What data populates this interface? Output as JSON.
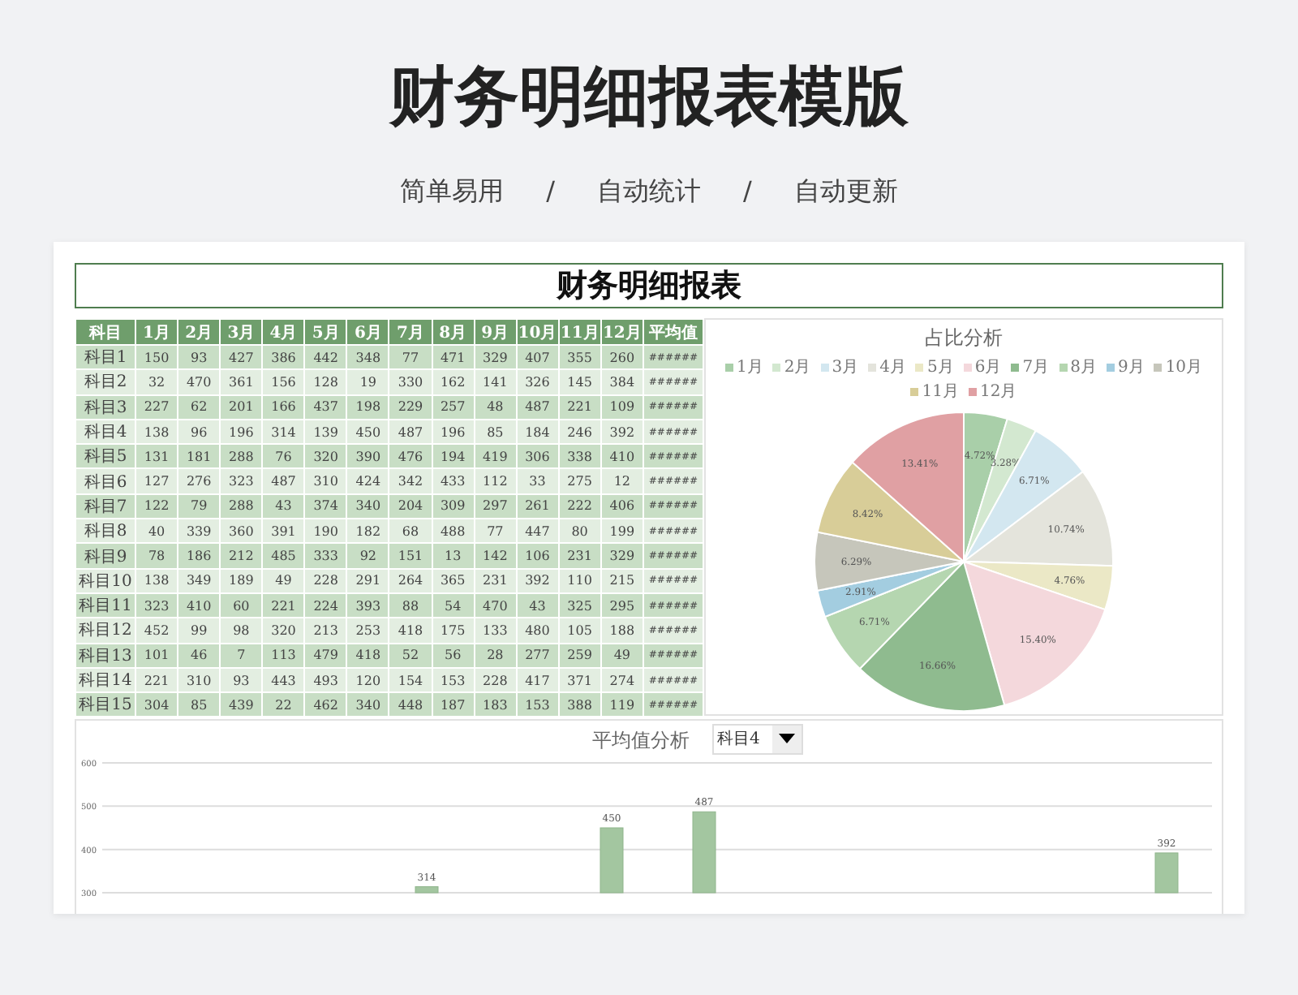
{
  "header": {
    "title": "财务明细报表模版",
    "tags": [
      "简单易用",
      "自动统计",
      "自动更新"
    ],
    "separators": [
      "/",
      "/"
    ]
  },
  "report": {
    "title": "财务明细报表",
    "table": {
      "columns": [
        "科目",
        "1月",
        "2月",
        "3月",
        "4月",
        "5月",
        "6月",
        "7月",
        "8月",
        "9月",
        "10月",
        "11月",
        "12月",
        "平均值"
      ],
      "rows": [
        [
          "科目1",
          "150",
          "93",
          "427",
          "386",
          "442",
          "348",
          "77",
          "471",
          "329",
          "407",
          "355",
          "260",
          "######"
        ],
        [
          "科目2",
          "32",
          "470",
          "361",
          "156",
          "128",
          "19",
          "330",
          "162",
          "141",
          "326",
          "145",
          "384",
          "######"
        ],
        [
          "科目3",
          "227",
          "62",
          "201",
          "166",
          "437",
          "198",
          "229",
          "257",
          "48",
          "487",
          "221",
          "109",
          "######"
        ],
        [
          "科目4",
          "138",
          "96",
          "196",
          "314",
          "139",
          "450",
          "487",
          "196",
          "85",
          "184",
          "246",
          "392",
          "######"
        ],
        [
          "科目5",
          "131",
          "181",
          "288",
          "76",
          "320",
          "390",
          "476",
          "194",
          "419",
          "306",
          "338",
          "410",
          "######"
        ],
        [
          "科目6",
          "127",
          "276",
          "323",
          "487",
          "310",
          "424",
          "342",
          "433",
          "112",
          "33",
          "275",
          "12",
          "######"
        ],
        [
          "科目7",
          "122",
          "79",
          "288",
          "43",
          "374",
          "340",
          "204",
          "309",
          "297",
          "261",
          "222",
          "406",
          "######"
        ],
        [
          "科目8",
          "40",
          "339",
          "360",
          "391",
          "190",
          "182",
          "68",
          "488",
          "77",
          "447",
          "80",
          "199",
          "######"
        ],
        [
          "科目9",
          "78",
          "186",
          "212",
          "485",
          "333",
          "92",
          "151",
          "13",
          "142",
          "106",
          "231",
          "329",
          "######"
        ],
        [
          "科目10",
          "138",
          "349",
          "189",
          "49",
          "228",
          "291",
          "264",
          "365",
          "231",
          "392",
          "110",
          "215",
          "######"
        ],
        [
          "科目11",
          "323",
          "410",
          "60",
          "221",
          "224",
          "393",
          "88",
          "54",
          "470",
          "43",
          "325",
          "295",
          "######"
        ],
        [
          "科目12",
          "452",
          "99",
          "98",
          "320",
          "213",
          "253",
          "418",
          "175",
          "133",
          "480",
          "105",
          "188",
          "######"
        ],
        [
          "科目13",
          "101",
          "46",
          "7",
          "113",
          "479",
          "418",
          "52",
          "56",
          "28",
          "277",
          "259",
          "49",
          "######"
        ],
        [
          "科目14",
          "221",
          "310",
          "93",
          "443",
          "493",
          "120",
          "154",
          "153",
          "228",
          "417",
          "371",
          "274",
          "######"
        ],
        [
          "科目15",
          "304",
          "85",
          "439",
          "22",
          "462",
          "340",
          "448",
          "187",
          "183",
          "153",
          "388",
          "119",
          "######"
        ]
      ]
    },
    "pie": {
      "legend": [
        {
          "label": "1月",
          "color": "#a9cfa9"
        },
        {
          "label": "2月",
          "color": "#d3e8d0"
        },
        {
          "label": "3月",
          "color": "#d3e7f0"
        },
        {
          "label": "4月",
          "color": "#e4e4dc"
        },
        {
          "label": "5月",
          "color": "#ebe8c6"
        },
        {
          "label": "6月",
          "color": "#f4d8dc"
        },
        {
          "label": "7月",
          "color": "#8fbb8f"
        },
        {
          "label": "8月",
          "color": "#b5d6b0"
        },
        {
          "label": "9月",
          "color": "#a3cde0"
        },
        {
          "label": "10月",
          "color": "#c6c6bb"
        },
        {
          "label": "11月",
          "color": "#d8cd98"
        },
        {
          "label": "12月",
          "color": "#e0a0a3"
        }
      ],
      "chart_data": {
        "type": "pie",
        "title": "占比分析",
        "values": [
          4.72,
          3.28,
          6.71,
          10.74,
          4.76,
          15.4,
          16.66,
          6.71,
          2.91,
          6.29,
          8.42,
          13.41
        ],
        "value_labels": [
          "4.72%",
          "3.28%",
          "6.71%",
          "10.74%",
          "4.76%",
          "15.40%",
          "16.66%",
          "6.71%",
          "2.91%",
          "6.29%",
          "8.42%",
          "13.41%"
        ]
      }
    },
    "average": {
      "selector": {
        "value": "科目4"
      },
      "chart_data": {
        "type": "bar",
        "title": "平均值分析",
        "values": [
          null,
          null,
          null,
          314,
          null,
          450,
          487,
          null,
          null,
          null,
          null,
          392
        ],
        "ylim": [
          300,
          600
        ],
        "yticks": [
          300,
          400,
          500,
          600
        ],
        "data_labels": true
      }
    }
  }
}
